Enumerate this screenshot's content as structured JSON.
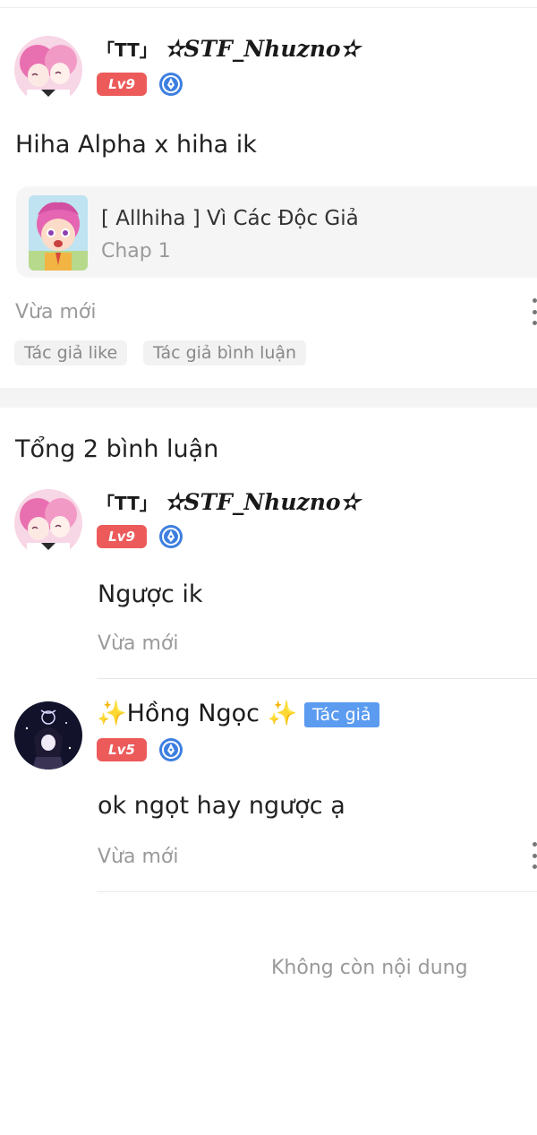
{
  "post": {
    "author": {
      "name_prefix": "「TT」",
      "name": "✫STF_Nhuzno✫",
      "level": "Lv9",
      "avatar_icon": "anime-girls-avatar",
      "role_icon": "pen-badge-icon"
    },
    "content": "Hiha Alpha x hiha ik",
    "book": {
      "title": "[ Allhiha ] Vì Các Độc Giả",
      "chapter": "Chap 1",
      "cover_icon": "pink-hair-boy-cover"
    },
    "timestamp": "Vừa mới",
    "tags": [
      "Tác giả like",
      "Tác giả bình luận"
    ]
  },
  "comments_section": {
    "heading": "Tổng 2 bình luận",
    "comments": [
      {
        "name_prefix": "「TT」",
        "name": "✫STF_Nhuzno✫",
        "level": "Lv9",
        "text": "Ngược ik",
        "timestamp": "Vừa mới",
        "avatar_icon": "anime-girls-avatar"
      },
      {
        "name": "✨Hồng Ngọc ✨",
        "author_badge": "Tác giả",
        "level": "Lv5",
        "text": "ok ngọt hay ngược ạ",
        "timestamp": "Vừa mới",
        "avatar_icon": "dark-zodiac-avatar"
      }
    ],
    "end_text": "Không còn nội dung"
  },
  "colors": {
    "level_badge": "#ec5a5a",
    "author_badge": "#5b9bf0",
    "pen_badge": "#3d7fe0",
    "muted_text": "#9a9a9a"
  }
}
